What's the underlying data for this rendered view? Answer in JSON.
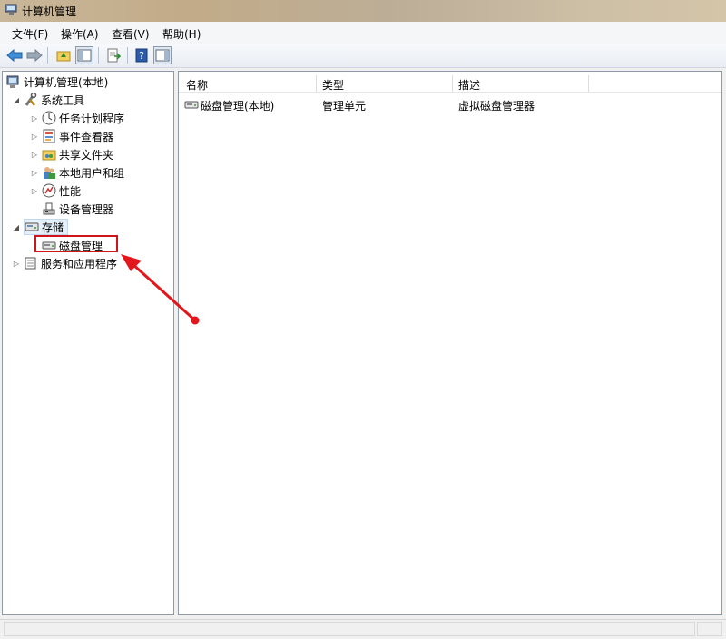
{
  "window": {
    "title": "计算机管理",
    "icon": "computer-management-icon"
  },
  "menu": [
    "文件(F)",
    "操作(A)",
    "查看(V)",
    "帮助(H)"
  ],
  "toolbar": [
    "back-icon",
    "forward-icon",
    "up-folder-icon",
    "show-hide-tree-icon",
    "export-list-icon",
    "help-icon",
    "show-hide-action-pane-icon"
  ],
  "tree": {
    "root": "计算机管理(本地)",
    "system_tools": "系统工具",
    "task_scheduler": "任务计划程序",
    "event_viewer": "事件查看器",
    "shared_folders": "共享文件夹",
    "local_users": "本地用户和组",
    "performance": "性能",
    "device_manager": "设备管理器",
    "storage": "存储",
    "disk_management": "磁盘管理",
    "services_apps": "服务和应用程序"
  },
  "list": {
    "columns": [
      "名称",
      "类型",
      "描述"
    ],
    "rows": [
      {
        "name": "磁盘管理(本地)",
        "type": "管理单元",
        "desc": "虚拟磁盘管理器"
      }
    ]
  },
  "colors": {
    "highlight": "#d1141a",
    "selection": "#e5f0fb"
  }
}
